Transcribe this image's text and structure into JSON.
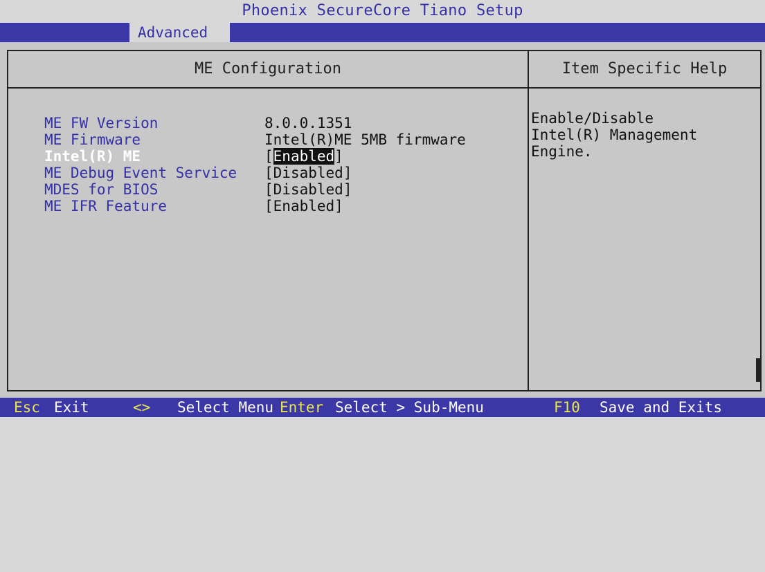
{
  "app": {
    "title": "Phoenix SecureCore Tiano Setup"
  },
  "menu": {
    "active_tab": "Advanced"
  },
  "panel": {
    "title": "ME Configuration",
    "help_title": "Item Specific Help",
    "help_text": "Enable/Disable\nIntel(R) Management\nEngine."
  },
  "settings": [
    {
      "label": "ME FW Version",
      "value": "8.0.0.1351"
    },
    {
      "label": "ME Firmware",
      "value": "Intel(R)ME 5MB firmware"
    },
    {
      "label": "Intel(R) ME",
      "value": "Enabled",
      "bracketed": true,
      "selected": true
    },
    {
      "label": "ME Debug Event Service",
      "value": "Disabled",
      "bracketed": true
    },
    {
      "label": "MDES for BIOS",
      "value": "Disabled",
      "bracketed": true
    },
    {
      "label": "ME IFR Feature",
      "value": "Enabled",
      "bracketed": true
    }
  ],
  "brackets": {
    "open": "[",
    "close": "]"
  },
  "statusbar": {
    "items": [
      {
        "key": "Esc",
        "action": "Exit"
      },
      {
        "key": "<>",
        "action": "Select Menu"
      },
      {
        "key": "Enter",
        "action": "Select > Sub-Menu"
      },
      {
        "key": "F10",
        "action": "Save and Exits"
      }
    ]
  },
  "colors": {
    "bar_blue": "#3b37a6",
    "label_blue": "#3430a8",
    "key_yellow": "#e8e84c",
    "panel_gray": "#c8c8c8"
  }
}
